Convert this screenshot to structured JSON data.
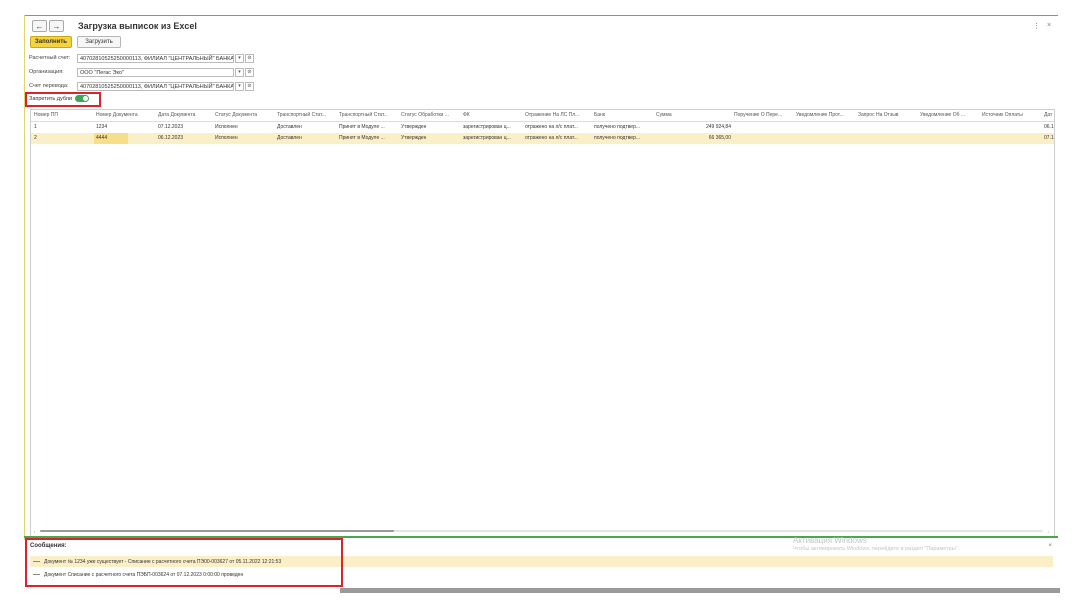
{
  "window": {
    "title": "Загрузка выписок из Excel",
    "back_label": "←",
    "forward_label": "→",
    "more_label": "⋮",
    "close_label": "×"
  },
  "toolbar": {
    "fill_label": "Заполнить",
    "load_label": "Загрузить"
  },
  "fields": {
    "account_label": "Расчетный счет:",
    "account_value": "40702810525250000113, ФИЛИАЛ \"ЦЕНТРАЛЬНЫЙ\" БАНКА",
    "org_label": "Организация:",
    "org_value": "ООО \"Пегас Эко\"",
    "transfer_label": "Счет перевода:",
    "transfer_value": "40702810525250000113, ФИЛИАЛ \"ЦЕНТРАЛЬНЫЙ\" БАНКА",
    "dropdown_glyph": "▾",
    "link_glyph": "⊘"
  },
  "toggle": {
    "label": "Запретить дубли",
    "state": "on"
  },
  "table": {
    "columns": [
      "Номер ПП",
      "Номер Документа",
      "Дата Документа",
      "Статус Документа",
      "Транспортный Стат...",
      "Транспортный Стат...",
      "Статус Обработки ...",
      "ФК",
      "Отражение На ЛС Пл...",
      "Банк",
      "Сумма",
      "Поручение О Пере...",
      "Уведомление Прот...",
      "Запрос На Отзыв",
      "Уведомление Об ...",
      "Источник Оплаты",
      "Дат"
    ],
    "rows": [
      {
        "cells": [
          "1",
          "1234",
          "07.12.2023",
          "Исполнен",
          "Доставлен",
          "Принят в Модуле ...",
          "Утвержден",
          "зарегистрирован ц...",
          "отражено на л/с плат...",
          "получено подтвер...",
          "249 924,84",
          "",
          "",
          "",
          "",
          "",
          "06.1"
        ]
      },
      {
        "cells": [
          "2",
          "4444",
          "06.12.2023",
          "Исполнен",
          "Доставлен",
          "Принят в Модуле ...",
          "Утвержден",
          "зарегистрирован ц...",
          "отражено на л/с плат...",
          "получено подтвер...",
          "66 365,00",
          "",
          "",
          "",
          "",
          "",
          "07.1"
        ]
      }
    ],
    "scroll_left": "‹",
    "scroll_right": "›"
  },
  "messages": {
    "title": "Сообщения:",
    "close_label": "×",
    "items": [
      "Документ № 1234 уже существует - Списание с расчетного счета ПЭ00-003627 от 05.11.2022 12:21:53",
      "Документ Списание с расчетного счета ПЭБП-003624 от 07.12.2023 0:00:00 проведен"
    ]
  },
  "watermark": {
    "line1": "Активация Windows",
    "line2": "Чтобы активировать Windows, перейдите в раздел \"Параметры\"."
  },
  "colors": {
    "accent_yellow": "#f5d33a",
    "selection": "#fbefc8",
    "toggle_green": "#3aa657",
    "highlight_red": "#d9232d",
    "separator_green": "#49a94a"
  }
}
